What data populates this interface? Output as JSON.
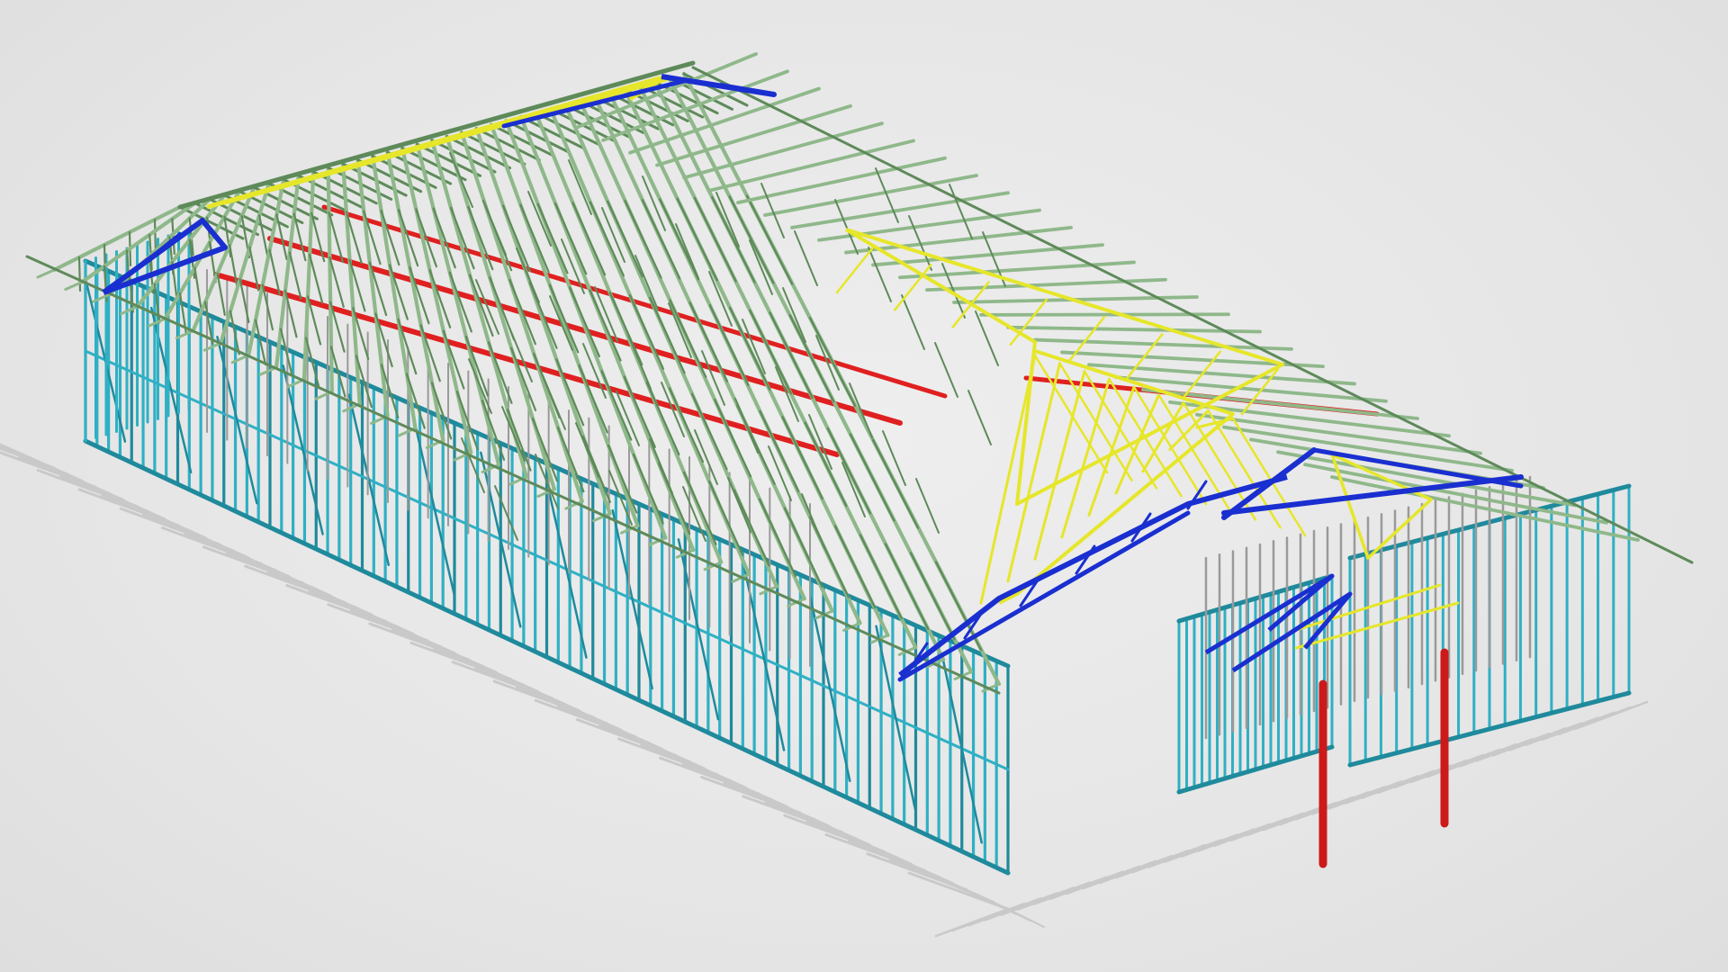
{
  "scene": {
    "type": "3d-steel-frame-model",
    "labels": [],
    "colors": {
      "background": "#e6e6e6",
      "wall_studs": "#2fb0c4",
      "wall_studs_dark": "#1f8a9c",
      "interior_walls": "#9a9a9a",
      "roof_trusses": "#8fb88a",
      "roof_trusses_dark": "#5e8a5a",
      "hip_girder_trusses": "#1a2fd0",
      "hip_trusses_yellow": "#e6e62a",
      "ridge_beams": "#e02020",
      "posts": "#cc1a1a",
      "shadow": "#c9c9c9"
    },
    "components": [
      {
        "name": "wall-frames",
        "icon": "wall-frame"
      },
      {
        "name": "roof-trusses",
        "icon": "truss"
      },
      {
        "name": "hip-girder-trusses",
        "icon": "truss"
      },
      {
        "name": "hip-jack-trusses",
        "icon": "truss"
      },
      {
        "name": "ridge-beams",
        "icon": "beam"
      },
      {
        "name": "porch-posts",
        "icon": "post"
      }
    ]
  }
}
